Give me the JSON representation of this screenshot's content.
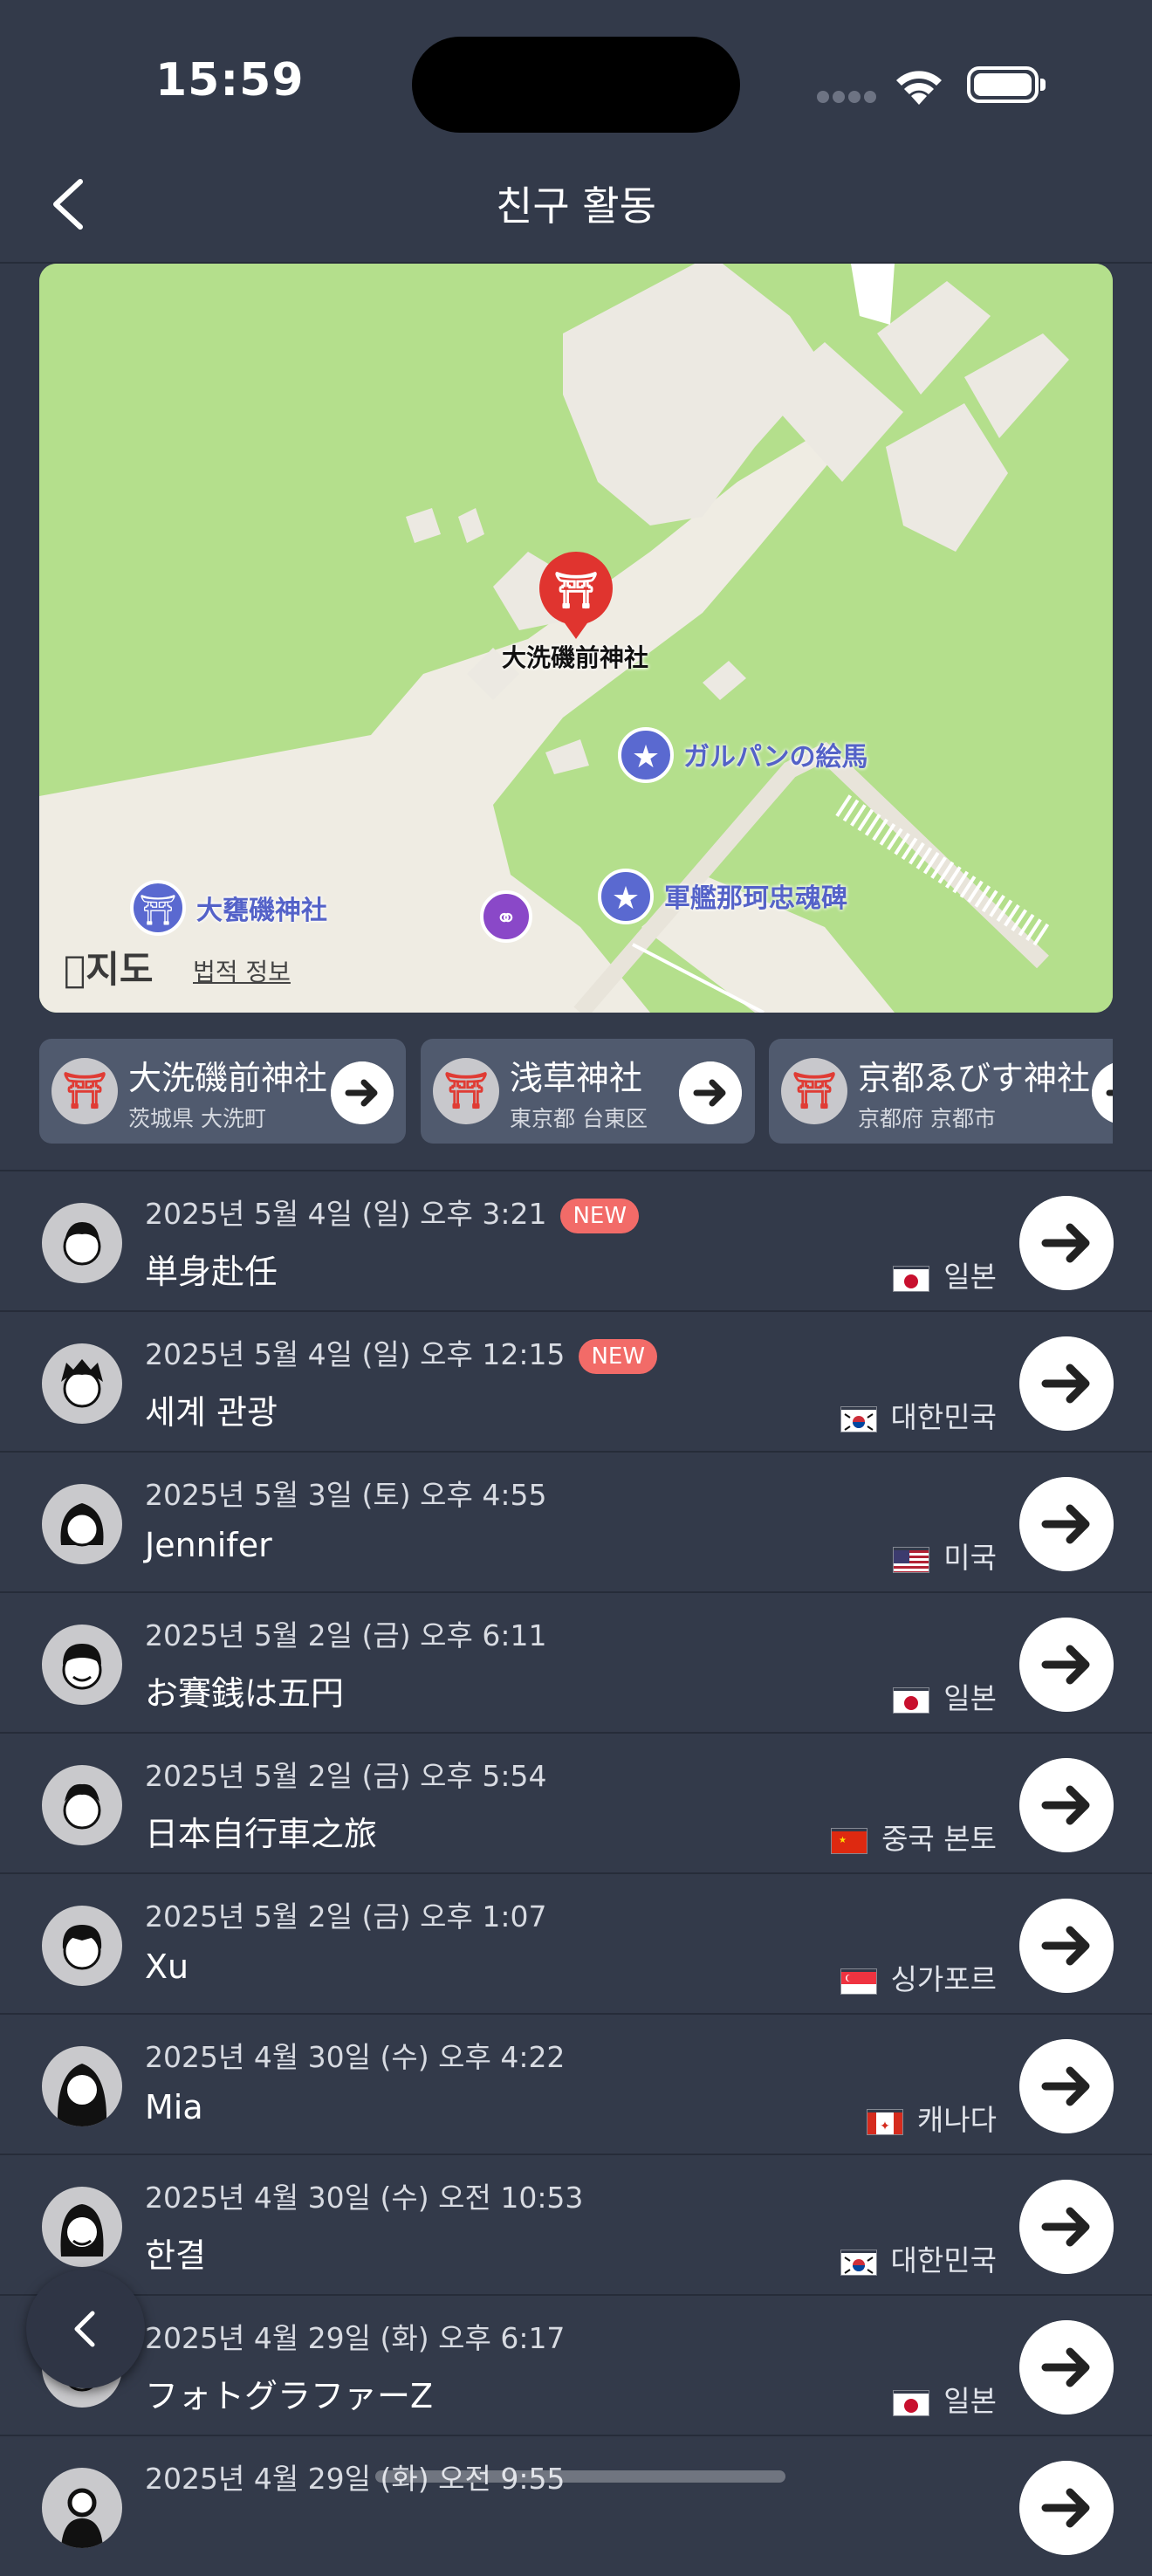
{
  "status_bar": {
    "time": "15:59"
  },
  "nav": {
    "title": "친구 활동",
    "back_icon": "chevron-left-icon"
  },
  "map": {
    "pin_label": "大洗磯前神社",
    "pois": [
      {
        "label": "ガルパンの絵馬",
        "icon": "star-icon"
      },
      {
        "label": "軍艦那珂忠魂碑",
        "icon": "star-icon"
      },
      {
        "label": "大甕磯神社",
        "icon": "torii-icon"
      }
    ],
    "logo": "지도",
    "legal": "법적 정보"
  },
  "shrines": [
    {
      "name": "大洗磯前神社",
      "location": "茨城県 大洗町"
    },
    {
      "name": "浅草神社",
      "location": "東京都 台東区"
    },
    {
      "name": "京都ゑびす神社",
      "location": "京都府 京都市"
    }
  ],
  "new_badge": "NEW",
  "activities": [
    {
      "date": "2025년 5월 4일 (일) 오후 3:21",
      "new": true,
      "name": "単身赴任",
      "country": "일본",
      "flag": "jp"
    },
    {
      "date": "2025년 5월 4일 (일) 오후 12:15",
      "new": true,
      "name": "세계 관광",
      "country": "대한민국",
      "flag": "kr"
    },
    {
      "date": "2025년 5월 3일 (토) 오후 4:55",
      "new": false,
      "name": "Jennifer",
      "country": "미국",
      "flag": "us"
    },
    {
      "date": "2025년 5월 2일 (금) 오후 6:11",
      "new": false,
      "name": "お賽銭は五円",
      "country": "일본",
      "flag": "jp"
    },
    {
      "date": "2025년 5월 2일 (금) 오후 5:54",
      "new": false,
      "name": "日本自行車之旅",
      "country": "중국 본토",
      "flag": "cn"
    },
    {
      "date": "2025년 5월 2일 (금) 오후 1:07",
      "new": false,
      "name": "Xu",
      "country": "싱가포르",
      "flag": "sg"
    },
    {
      "date": "2025년 4월 30일 (수) 오후 4:22",
      "new": false,
      "name": "Mia",
      "country": "캐나다",
      "flag": "ca"
    },
    {
      "date": "2025년 4월 30일 (수) 오전 10:53",
      "new": false,
      "name": "한결",
      "country": "대한민국",
      "flag": "kr"
    },
    {
      "date": "2025년 4월 29일 (화) 오후 6:17",
      "new": false,
      "name": "フォトグラファーZ",
      "country": "일본",
      "flag": "jp"
    },
    {
      "date": "2025년 4월 29일 (화) 오전 9:55",
      "new": false,
      "name": "",
      "country": "",
      "flag": ""
    }
  ]
}
